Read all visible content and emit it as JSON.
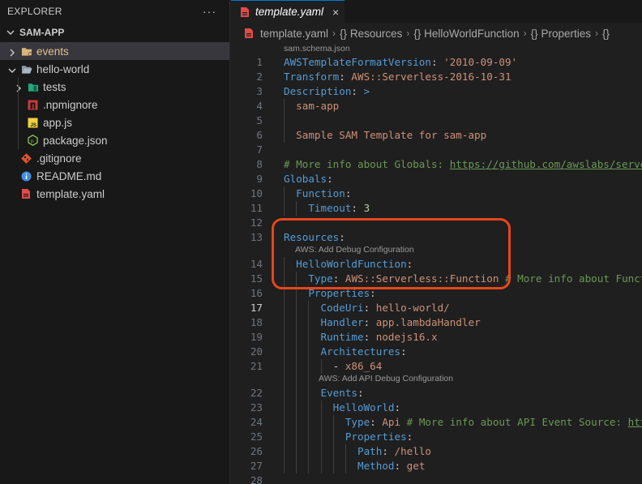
{
  "sidebar": {
    "title": "EXPLORER",
    "more": "···",
    "project": "SAM-APP",
    "items": [
      {
        "label": "events",
        "icon": "folder-icon",
        "color": "#e2c08d"
      },
      {
        "label": "hello-world",
        "icon": "folder-open-icon",
        "color": "#cccccc"
      },
      {
        "label": "tests",
        "icon": "folder-tests-icon",
        "color": "#cccccc"
      },
      {
        "label": ".npmignore",
        "icon": "npm-icon",
        "color": "#cccccc"
      },
      {
        "label": "app.js",
        "icon": "js-file-icon",
        "color": "#cccccc"
      },
      {
        "label": "package.json",
        "icon": "nodejs-icon",
        "color": "#cccccc"
      },
      {
        "label": ".gitignore",
        "icon": "git-icon",
        "color": "#cccccc"
      },
      {
        "label": "README.md",
        "icon": "info-icon",
        "color": "#cccccc"
      },
      {
        "label": "template.yaml",
        "icon": "yaml-file-icon",
        "color": "#cccccc"
      }
    ]
  },
  "editor": {
    "tab": {
      "label": "template.yaml",
      "close": "×"
    },
    "breadcrumbs": [
      "template.yaml",
      "{} Resources",
      "{} HelloWorldFunction",
      "{} Properties",
      "{}"
    ],
    "schema_lens": "sam.schema.json",
    "lens_debug": "AWS: Add Debug Configuration",
    "lens_api_debug": "AWS: Add API Debug Configuration",
    "current_line": "17",
    "colors": {
      "key": "#569cd6",
      "string": "#ce9178",
      "comment": "#6a9955",
      "number": "#b5cea8",
      "highlight_box": "#e8461a"
    },
    "lines": [
      {
        "n": "1",
        "t": [
          {
            "v": "AWSTemplateFormatVersion",
            "c": "k"
          },
          {
            "v": ": ",
            "c": "p"
          },
          {
            "v": "'2010-09-09'",
            "c": "s"
          }
        ]
      },
      {
        "n": "2",
        "t": [
          {
            "v": "Transform",
            "c": "k"
          },
          {
            "v": ": ",
            "c": "p"
          },
          {
            "v": "AWS::Serverless-2016-10-31",
            "c": "s"
          }
        ]
      },
      {
        "n": "3",
        "t": [
          {
            "v": "Description",
            "c": "k"
          },
          {
            "v": ": ",
            "c": "p"
          },
          {
            "v": ">",
            "c": "k"
          }
        ]
      },
      {
        "n": "4",
        "t": [
          {
            "v": "  sam-app",
            "c": "s"
          }
        ]
      },
      {
        "n": "5",
        "t": []
      },
      {
        "n": "6",
        "t": [
          {
            "v": "  Sample SAM Template for sam-app",
            "c": "s"
          }
        ]
      },
      {
        "n": "7",
        "t": []
      },
      {
        "n": "8",
        "t": [
          {
            "v": "# More info about Globals: ",
            "c": "c"
          },
          {
            "v": "https://github.com/awslabs/serverle",
            "c": "cu"
          }
        ]
      },
      {
        "n": "9",
        "t": [
          {
            "v": "Globals",
            "c": "k"
          },
          {
            "v": ":",
            "c": "p"
          }
        ]
      },
      {
        "n": "10",
        "t": [
          {
            "v": "  ",
            "c": "p"
          },
          {
            "v": "Function",
            "c": "k"
          },
          {
            "v": ":",
            "c": "p"
          }
        ]
      },
      {
        "n": "11",
        "t": [
          {
            "v": "    ",
            "c": "p"
          },
          {
            "v": "Timeout",
            "c": "k"
          },
          {
            "v": ": ",
            "c": "p"
          },
          {
            "v": "3",
            "c": "n"
          }
        ]
      },
      {
        "n": "12",
        "t": []
      },
      {
        "n": "13",
        "t": [
          {
            "v": "Resources",
            "c": "k"
          },
          {
            "v": ":",
            "c": "p"
          }
        ]
      },
      {
        "n": "14",
        "t": [
          {
            "v": "  ",
            "c": "p"
          },
          {
            "v": "HelloWorldFunction",
            "c": "k"
          },
          {
            "v": ":",
            "c": "p"
          }
        ]
      },
      {
        "n": "15",
        "t": [
          {
            "v": "    ",
            "c": "p"
          },
          {
            "v": "Type",
            "c": "k"
          },
          {
            "v": ": ",
            "c": "p"
          },
          {
            "v": "AWS::Serverless::Function",
            "c": "s"
          },
          {
            "v": " # More info about Functio",
            "c": "c"
          }
        ]
      },
      {
        "n": "16",
        "t": [
          {
            "v": "    ",
            "c": "p"
          },
          {
            "v": "Properties",
            "c": "k"
          },
          {
            "v": ":",
            "c": "p"
          }
        ]
      },
      {
        "n": "17",
        "t": [
          {
            "v": "      ",
            "c": "p"
          },
          {
            "v": "CodeUri",
            "c": "k"
          },
          {
            "v": ": ",
            "c": "p"
          },
          {
            "v": "hello-world/",
            "c": "s"
          }
        ]
      },
      {
        "n": "18",
        "t": [
          {
            "v": "      ",
            "c": "p"
          },
          {
            "v": "Handler",
            "c": "k"
          },
          {
            "v": ": ",
            "c": "p"
          },
          {
            "v": "app.lambdaHandler",
            "c": "s"
          }
        ]
      },
      {
        "n": "19",
        "t": [
          {
            "v": "      ",
            "c": "p"
          },
          {
            "v": "Runtime",
            "c": "k"
          },
          {
            "v": ": ",
            "c": "p"
          },
          {
            "v": "nodejs16.x",
            "c": "s"
          }
        ]
      },
      {
        "n": "20",
        "t": [
          {
            "v": "      ",
            "c": "p"
          },
          {
            "v": "Architectures",
            "c": "k"
          },
          {
            "v": ":",
            "c": "p"
          }
        ]
      },
      {
        "n": "21",
        "t": [
          {
            "v": "        - ",
            "c": "p"
          },
          {
            "v": "x86_64",
            "c": "s"
          }
        ]
      },
      {
        "n": "22",
        "t": [
          {
            "v": "      ",
            "c": "p"
          },
          {
            "v": "Events",
            "c": "k"
          },
          {
            "v": ":",
            "c": "p"
          }
        ]
      },
      {
        "n": "23",
        "t": [
          {
            "v": "        ",
            "c": "p"
          },
          {
            "v": "HelloWorld",
            "c": "k"
          },
          {
            "v": ":",
            "c": "p"
          }
        ]
      },
      {
        "n": "24",
        "t": [
          {
            "v": "          ",
            "c": "p"
          },
          {
            "v": "Type",
            "c": "k"
          },
          {
            "v": ": ",
            "c": "p"
          },
          {
            "v": "Api",
            "c": "s"
          },
          {
            "v": " # More info about API Event Source: ",
            "c": "c"
          },
          {
            "v": "https",
            "c": "cu"
          }
        ]
      },
      {
        "n": "25",
        "t": [
          {
            "v": "          ",
            "c": "p"
          },
          {
            "v": "Properties",
            "c": "k"
          },
          {
            "v": ":",
            "c": "p"
          }
        ]
      },
      {
        "n": "26",
        "t": [
          {
            "v": "            ",
            "c": "p"
          },
          {
            "v": "Path",
            "c": "k"
          },
          {
            "v": ": ",
            "c": "p"
          },
          {
            "v": "/hello",
            "c": "s"
          }
        ]
      },
      {
        "n": "27",
        "t": [
          {
            "v": "            ",
            "c": "p"
          },
          {
            "v": "Method",
            "c": "k"
          },
          {
            "v": ": ",
            "c": "p"
          },
          {
            "v": "get",
            "c": "s"
          }
        ]
      },
      {
        "n": "28",
        "t": []
      }
    ]
  }
}
